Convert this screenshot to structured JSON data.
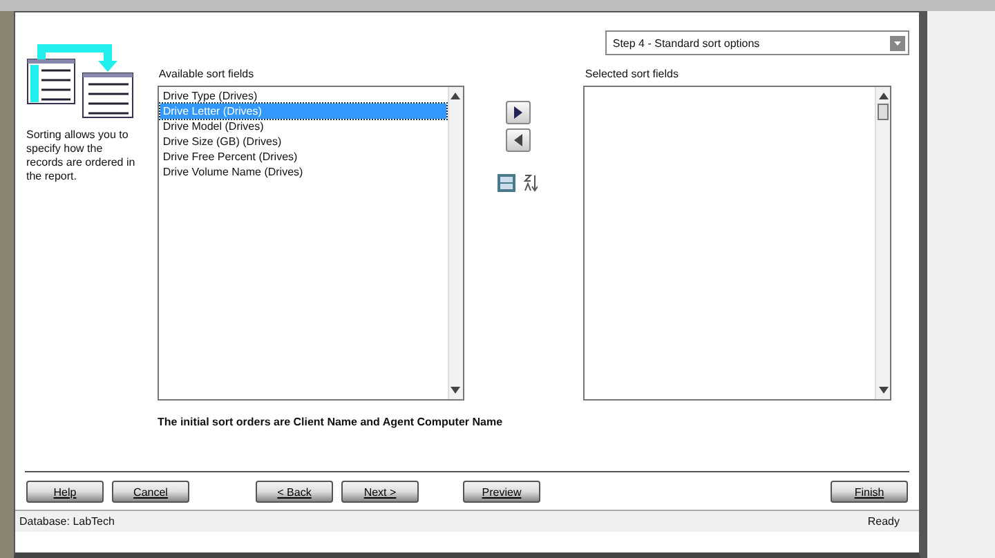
{
  "step_dropdown": {
    "value": "Step 4 - Standard sort options"
  },
  "description": "Sorting allows you to specify how the records are ordered in the report.",
  "available": {
    "label": "Available sort fields",
    "items": [
      {
        "label": "Drive Type (Drives)",
        "selected": false
      },
      {
        "label": "Drive Letter (Drives)",
        "selected": true
      },
      {
        "label": "Drive Model (Drives)",
        "selected": false
      },
      {
        "label": "Drive Size (GB) (Drives)",
        "selected": false
      },
      {
        "label": "Drive Free Percent (Drives)",
        "selected": false
      },
      {
        "label": "Drive Volume Name (Drives)",
        "selected": false
      }
    ]
  },
  "selected_fields": {
    "label": "Selected sort fields"
  },
  "note": "The initial sort orders are Client Name and Agent Computer Name",
  "buttons": [
    {
      "label": "Help",
      "kind": "left"
    },
    {
      "label": "Cancel",
      "kind": "left"
    },
    {
      "label": "< Back",
      "kind": "nav"
    },
    {
      "label": "Next >",
      "kind": "nav"
    },
    {
      "label": "Preview",
      "kind": "preview"
    },
    {
      "label": "Finish",
      "kind": "finish"
    }
  ],
  "status_bar": {
    "left": "Database: LabTech",
    "right": "Ready"
  }
}
